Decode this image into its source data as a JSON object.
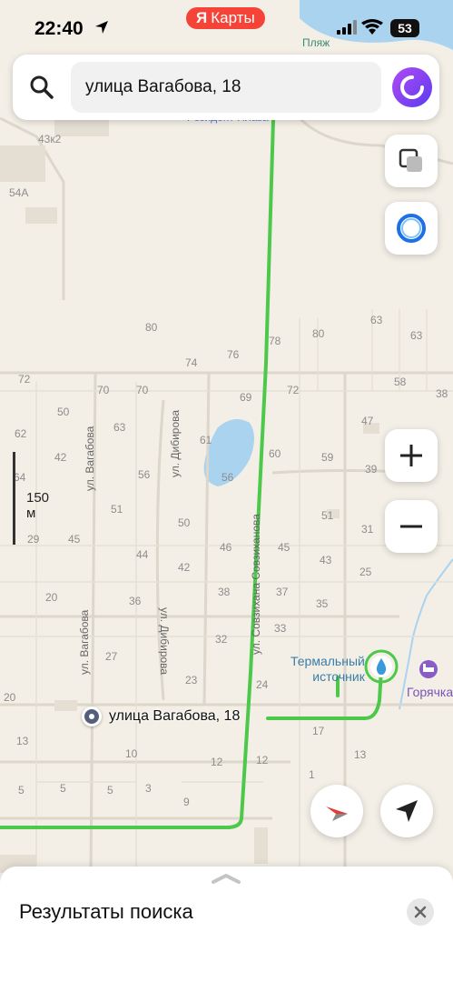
{
  "status_bar": {
    "time": "22:40",
    "battery": "53"
  },
  "brand": {
    "logo_letter": "Я",
    "name": "Карты"
  },
  "search": {
    "query": "улица Вагабова, 18"
  },
  "map": {
    "scale_label": "150 м",
    "top_labels": {
      "beach": "Пляж",
      "resident_plaza": "Резидент Плаза"
    },
    "streets": {
      "vagabova_1": "ул. Вагабова",
      "vagabova_2": "ул. Вагабова",
      "dibirova_1": "ул. Дибирова",
      "dibirova_2": "ул. Дибирова",
      "sovzikhanova_1": "ул. Совзихана Совзиханова",
      "sovzikhanova_2": "ул. Совзихана Совзиханова"
    },
    "house_numbers": [
      "43к2",
      "54А",
      "80",
      "76",
      "78",
      "74",
      "72",
      "70",
      "70",
      "69",
      "72",
      "80",
      "63",
      "63",
      "58",
      "38",
      "50",
      "63",
      "62",
      "61",
      "47",
      "42",
      "60",
      "59",
      "56",
      "56",
      "64",
      "39",
      "51",
      "50",
      "51",
      "31",
      "29",
      "45",
      "46",
      "45",
      "43",
      "44",
      "42",
      "25",
      "20",
      "38",
      "37",
      "35",
      "36",
      "32",
      "33",
      "27",
      "23",
      "24",
      "20",
      "17",
      "13",
      "10",
      "12",
      "12",
      "13",
      "5",
      "5",
      "5",
      "3",
      "9",
      "1"
    ],
    "pin_label": "улица Вагабова, 18",
    "poi_thermal": "Термальный\nисточник",
    "poi_hotel": "Горячка"
  },
  "sheet": {
    "title": "Результаты поиска"
  }
}
